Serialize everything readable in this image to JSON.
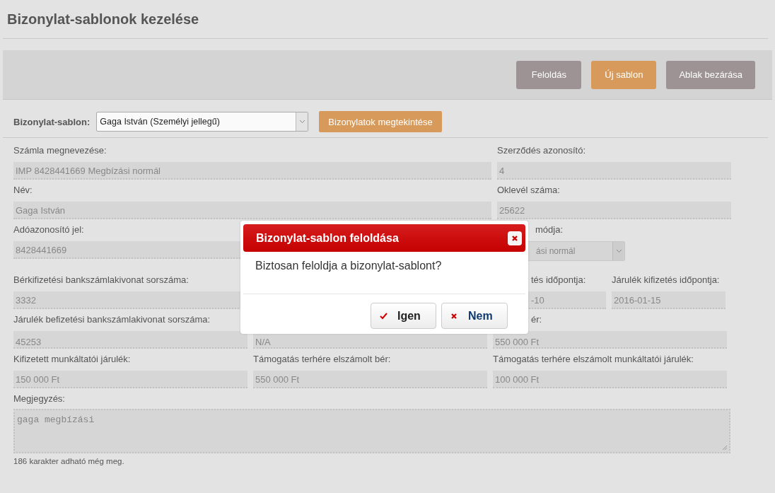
{
  "page_title": "Bizonylat-sablonok kezelése",
  "toolbar": [
    {
      "label": "Feloldás",
      "kind": "neutral"
    },
    {
      "label": "Új sablon",
      "kind": "primary"
    },
    {
      "label": "Ablak bezárása",
      "kind": "neutral"
    }
  ],
  "template_selector": {
    "label": "Bizonylat-sablon:",
    "value": "Gaga István (Személyi jellegű)",
    "button": "Bizonylatok megtekintése"
  },
  "form_rows": [
    {
      "kind": "wide",
      "fields": [
        {
          "label": "Számla megnevezése:",
          "value": "IMP 8428441669 Megbízási normál",
          "kind": "text"
        },
        {
          "label": "Szerződés azonosító:",
          "value": "4",
          "kind": "text"
        }
      ]
    },
    {
      "kind": "wide",
      "fields": [
        {
          "label": "Név:",
          "value": "Gaga István",
          "kind": "text"
        },
        {
          "label": "Oklevél száma:",
          "value": "25622",
          "kind": "text"
        }
      ]
    },
    {
      "kind": "wide-select",
      "fields": [
        {
          "label": "Adóazonosító jel:",
          "value": "8428441669",
          "kind": "text"
        },
        {
          "label": "módja:",
          "value": "ási normál",
          "kind": "select"
        }
      ]
    },
    {
      "kind": "dates",
      "fields": [
        {
          "label": "Bérkifizetési bankszámlakivonat sorszáma:",
          "value": "3332",
          "kind": "text"
        },
        {
          "label": "tés időpontja:",
          "value": "-10",
          "kind": "text"
        },
        {
          "label": "Járulék kifizetés időpontja:",
          "value": "2016-01-15",
          "kind": "text"
        }
      ]
    },
    {
      "kind": "triple",
      "fields": [
        {
          "label": "Járulék befizetési bankszámlakivonat sorszáma:",
          "value": "45253",
          "kind": "text"
        },
        {
          "value": "N/A",
          "kind": "text"
        },
        {
          "label": "ér:",
          "value": "550 000 Ft",
          "kind": "text"
        }
      ]
    },
    {
      "kind": "triple",
      "fields": [
        {
          "label": "Kifizetett munkáltatói járulék:",
          "value": "150 000 Ft",
          "kind": "text"
        },
        {
          "label": "Támogatás terhére elszámolt bér:",
          "value": "550 000 Ft",
          "kind": "text"
        },
        {
          "label": "Támogatás terhére elszámolt munkáltatói járulék:",
          "value": "100 000 Ft",
          "kind": "text"
        }
      ]
    }
  ],
  "note": {
    "label": "Megjegyzés:",
    "value": "gaga megbízási",
    "counter": "186 karakter adható még meg."
  },
  "dialog": {
    "title": "Bizonylat-sablon feloldása",
    "message": "Biztosan feloldja a bizonylat-sablont?",
    "buttons": [
      {
        "label": "Igen",
        "kind": "confirm"
      },
      {
        "label": "Nem",
        "kind": "cancel"
      }
    ]
  }
}
